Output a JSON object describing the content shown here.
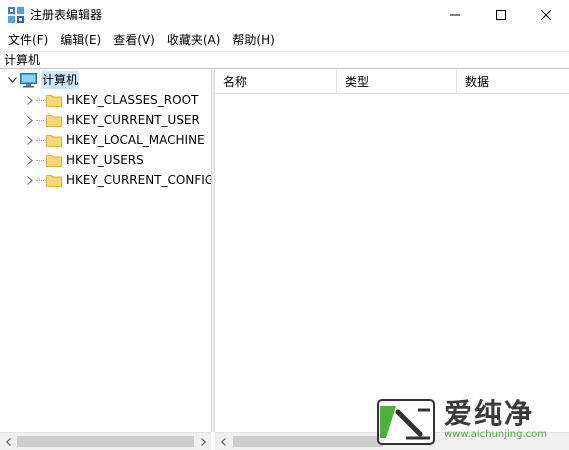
{
  "window": {
    "title": "注册表编辑器"
  },
  "menu": [
    {
      "label": "文件(F)"
    },
    {
      "label": "编辑(E)"
    },
    {
      "label": "查看(V)"
    },
    {
      "label": "收藏夹(A)"
    },
    {
      "label": "帮助(H)"
    }
  ],
  "address": "计算机",
  "tree": {
    "root_label": "计算机",
    "items": [
      {
        "label": "HKEY_CLASSES_ROOT"
      },
      {
        "label": "HKEY_CURRENT_USER"
      },
      {
        "label": "HKEY_LOCAL_MACHINE"
      },
      {
        "label": "HKEY_USERS"
      },
      {
        "label": "HKEY_CURRENT_CONFIG"
      }
    ]
  },
  "list": {
    "columns": [
      {
        "label": "名称"
      },
      {
        "label": "类型"
      },
      {
        "label": "数据"
      }
    ]
  },
  "watermark": {
    "text": "爱纯净",
    "url": "www.aichunjing.com"
  },
  "colors": {
    "selection": "#cce8ff",
    "folder": "#f8d775",
    "watermark_green": "#4caf3b"
  }
}
